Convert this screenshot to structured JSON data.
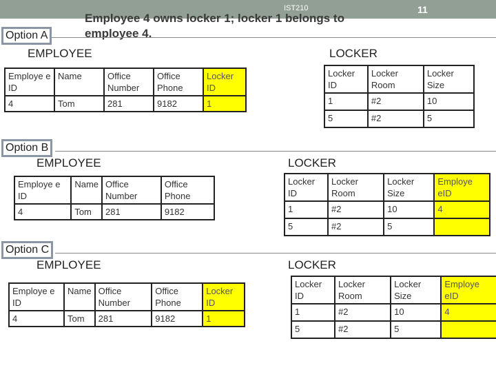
{
  "header": {
    "course": "IST210",
    "page_number": "11"
  },
  "title": "Employee 4 owns locker 1; locker 1 belongs to employee 4.",
  "colors": {
    "header_bar": "#919f94",
    "highlight": "#ffff00",
    "option_border": "#8a96a4"
  },
  "options": [
    {
      "label": "Option A",
      "employee": {
        "title": "EMPLOYEE",
        "headers": [
          "Employe e ID",
          "Name",
          "Office Number",
          "Office Phone",
          "Locker ID"
        ],
        "rows": [
          [
            "4",
            "Tom",
            "281",
            "9182",
            "1"
          ]
        ],
        "highlight_column": 4
      },
      "locker": {
        "title": "LOCKER",
        "headers": [
          "Locker ID",
          "Locker Room",
          "Locker Size"
        ],
        "rows": [
          [
            "1",
            "#2",
            "10"
          ],
          [
            "5",
            "#2",
            "5"
          ]
        ]
      }
    },
    {
      "label": "Option B",
      "employee": {
        "title": "EMPLOYEE",
        "headers": [
          "Employe e ID",
          "Name",
          "Office Number",
          "Office Phone"
        ],
        "rows": [
          [
            "4",
            "Tom",
            "281",
            "9182"
          ]
        ]
      },
      "locker": {
        "title": "LOCKER",
        "headers": [
          "Locker ID",
          "Locker Room",
          "Locker Size",
          "Employe eID"
        ],
        "rows": [
          [
            "1",
            "#2",
            "10",
            "4"
          ],
          [
            "5",
            "#2",
            "5",
            ""
          ]
        ],
        "highlight_column": 3
      }
    },
    {
      "label": "Option C",
      "employee": {
        "title": "EMPLOYEE",
        "headers": [
          "Employe e ID",
          "Name",
          "Office Number",
          "Office Phone",
          "Locker ID"
        ],
        "rows": [
          [
            "4",
            "Tom",
            "281",
            "9182",
            "1"
          ]
        ],
        "highlight_column": 4
      },
      "locker": {
        "title": "LOCKER",
        "headers": [
          "Locker ID",
          "Locker Room",
          "Locker Size",
          "Employe eID"
        ],
        "rows": [
          [
            "1",
            "#2",
            "10",
            "4"
          ],
          [
            "5",
            "#2",
            "5",
            ""
          ]
        ],
        "highlight_column": 3
      }
    }
  ]
}
